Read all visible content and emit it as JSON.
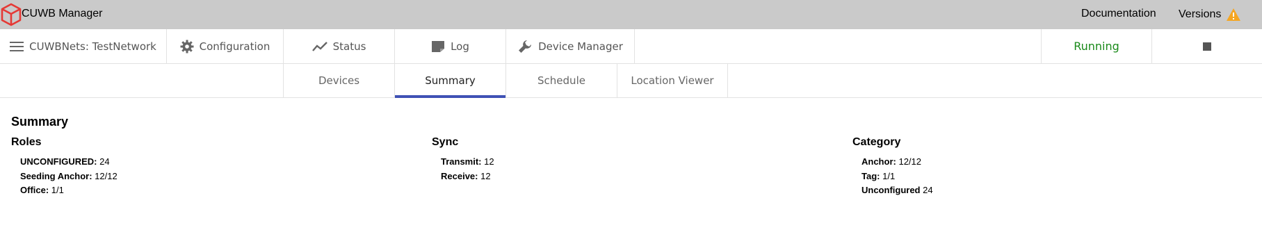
{
  "app": {
    "title": "CUWB Manager",
    "brand_color": "#e53935"
  },
  "top_links": {
    "documentation": "Documentation",
    "versions": "Versions"
  },
  "nav": {
    "network": "CUWBNets: TestNetwork",
    "configuration": "Configuration",
    "status": "Status",
    "log": "Log",
    "device_manager": "Device Manager",
    "running": "Running",
    "running_color": "#1a8a1a"
  },
  "tabs": {
    "devices": "Devices",
    "summary": "Summary",
    "schedule": "Schedule",
    "location_viewer": "Location Viewer",
    "active": "Summary",
    "accent_color": "#3f51b5"
  },
  "summary": {
    "title": "Summary",
    "roles": {
      "title": "Roles",
      "items": [
        {
          "label": "UNCONFIGURED:",
          "value": "24"
        },
        {
          "label": "Seeding Anchor:",
          "value": "12/12"
        },
        {
          "label": "Office:",
          "value": "1/1"
        }
      ]
    },
    "sync": {
      "title": "Sync",
      "items": [
        {
          "label": "Transmit:",
          "value": "12"
        },
        {
          "label": "Receive:",
          "value": "12"
        }
      ]
    },
    "category": {
      "title": "Category",
      "items": [
        {
          "label": "Anchor:",
          "value": "12/12"
        },
        {
          "label": "Tag:",
          "value": "1/1"
        },
        {
          "label": "Unconfigured",
          "value": "24"
        }
      ]
    }
  },
  "icons": {
    "logo": "cube-logo-icon",
    "warning": "warning-icon",
    "menu": "menu-icon",
    "gear": "gear-icon",
    "chart": "chart-line-icon",
    "log": "note-icon",
    "wrench": "wrench-icon",
    "stop": "stop-icon"
  }
}
